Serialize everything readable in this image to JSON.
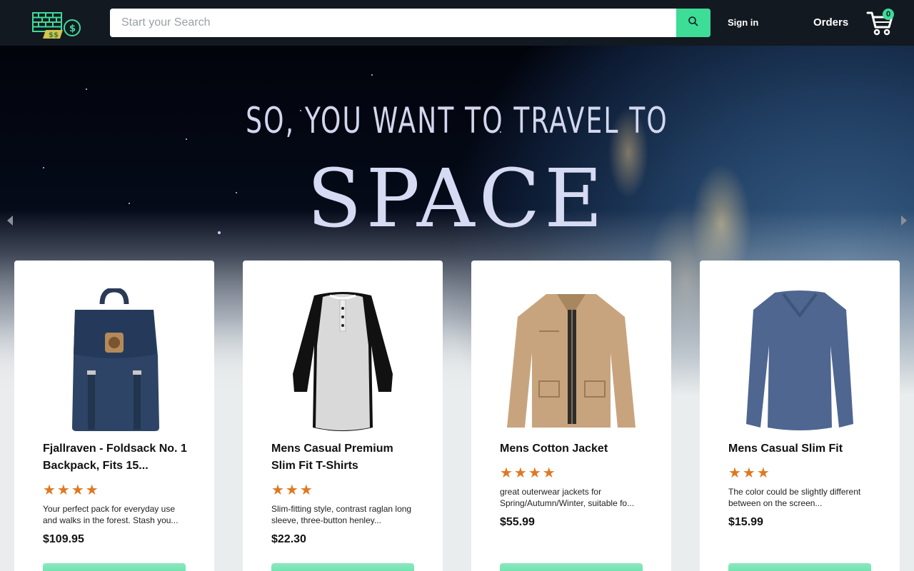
{
  "header": {
    "logo_icon": "money-bricks-logo-icon",
    "search": {
      "placeholder": "Start your Search",
      "value": "",
      "button_icon": "search-icon"
    },
    "signin_label": "Sign in",
    "orders_label": "Orders",
    "cart": {
      "icon": "cart-icon",
      "count": "0"
    }
  },
  "hero": {
    "line1": "SO, YOU WANT TO TRAVEL TO",
    "line2": "SPACE",
    "prev_icon": "caret-left-icon",
    "next_icon": "caret-right-icon"
  },
  "products": [
    {
      "title": "Fjallraven - Foldsack No. 1 Backpack, Fits 15...",
      "rating": "★★★★",
      "rating_value": 4,
      "description": "Your perfect pack for everyday use and walks in the forest. Stash you...",
      "price": "$109.95",
      "image_icon": "backpack-image"
    },
    {
      "title": "Mens Casual Premium Slim Fit T-Shirts",
      "rating": "★★★",
      "rating_value": 3,
      "description": "Slim-fitting style, contrast raglan long sleeve, three-button henley...",
      "price": "$22.30",
      "image_icon": "tshirt-image"
    },
    {
      "title": "Mens Cotton Jacket",
      "rating": "★★★★",
      "rating_value": 4,
      "description": "great outerwear jackets for Spring/Autumn/Winter, suitable fo...",
      "price": "$55.99",
      "image_icon": "jacket-image"
    },
    {
      "title": "Mens Casual Slim Fit",
      "rating": "★★★",
      "rating_value": 3,
      "description": "The color could be slightly different between on the screen...",
      "price": "$15.99",
      "image_icon": "longsleeve-image"
    }
  ],
  "colors": {
    "header_bg": "#131921",
    "accent": "#3ddc97",
    "star": "#de7921"
  }
}
